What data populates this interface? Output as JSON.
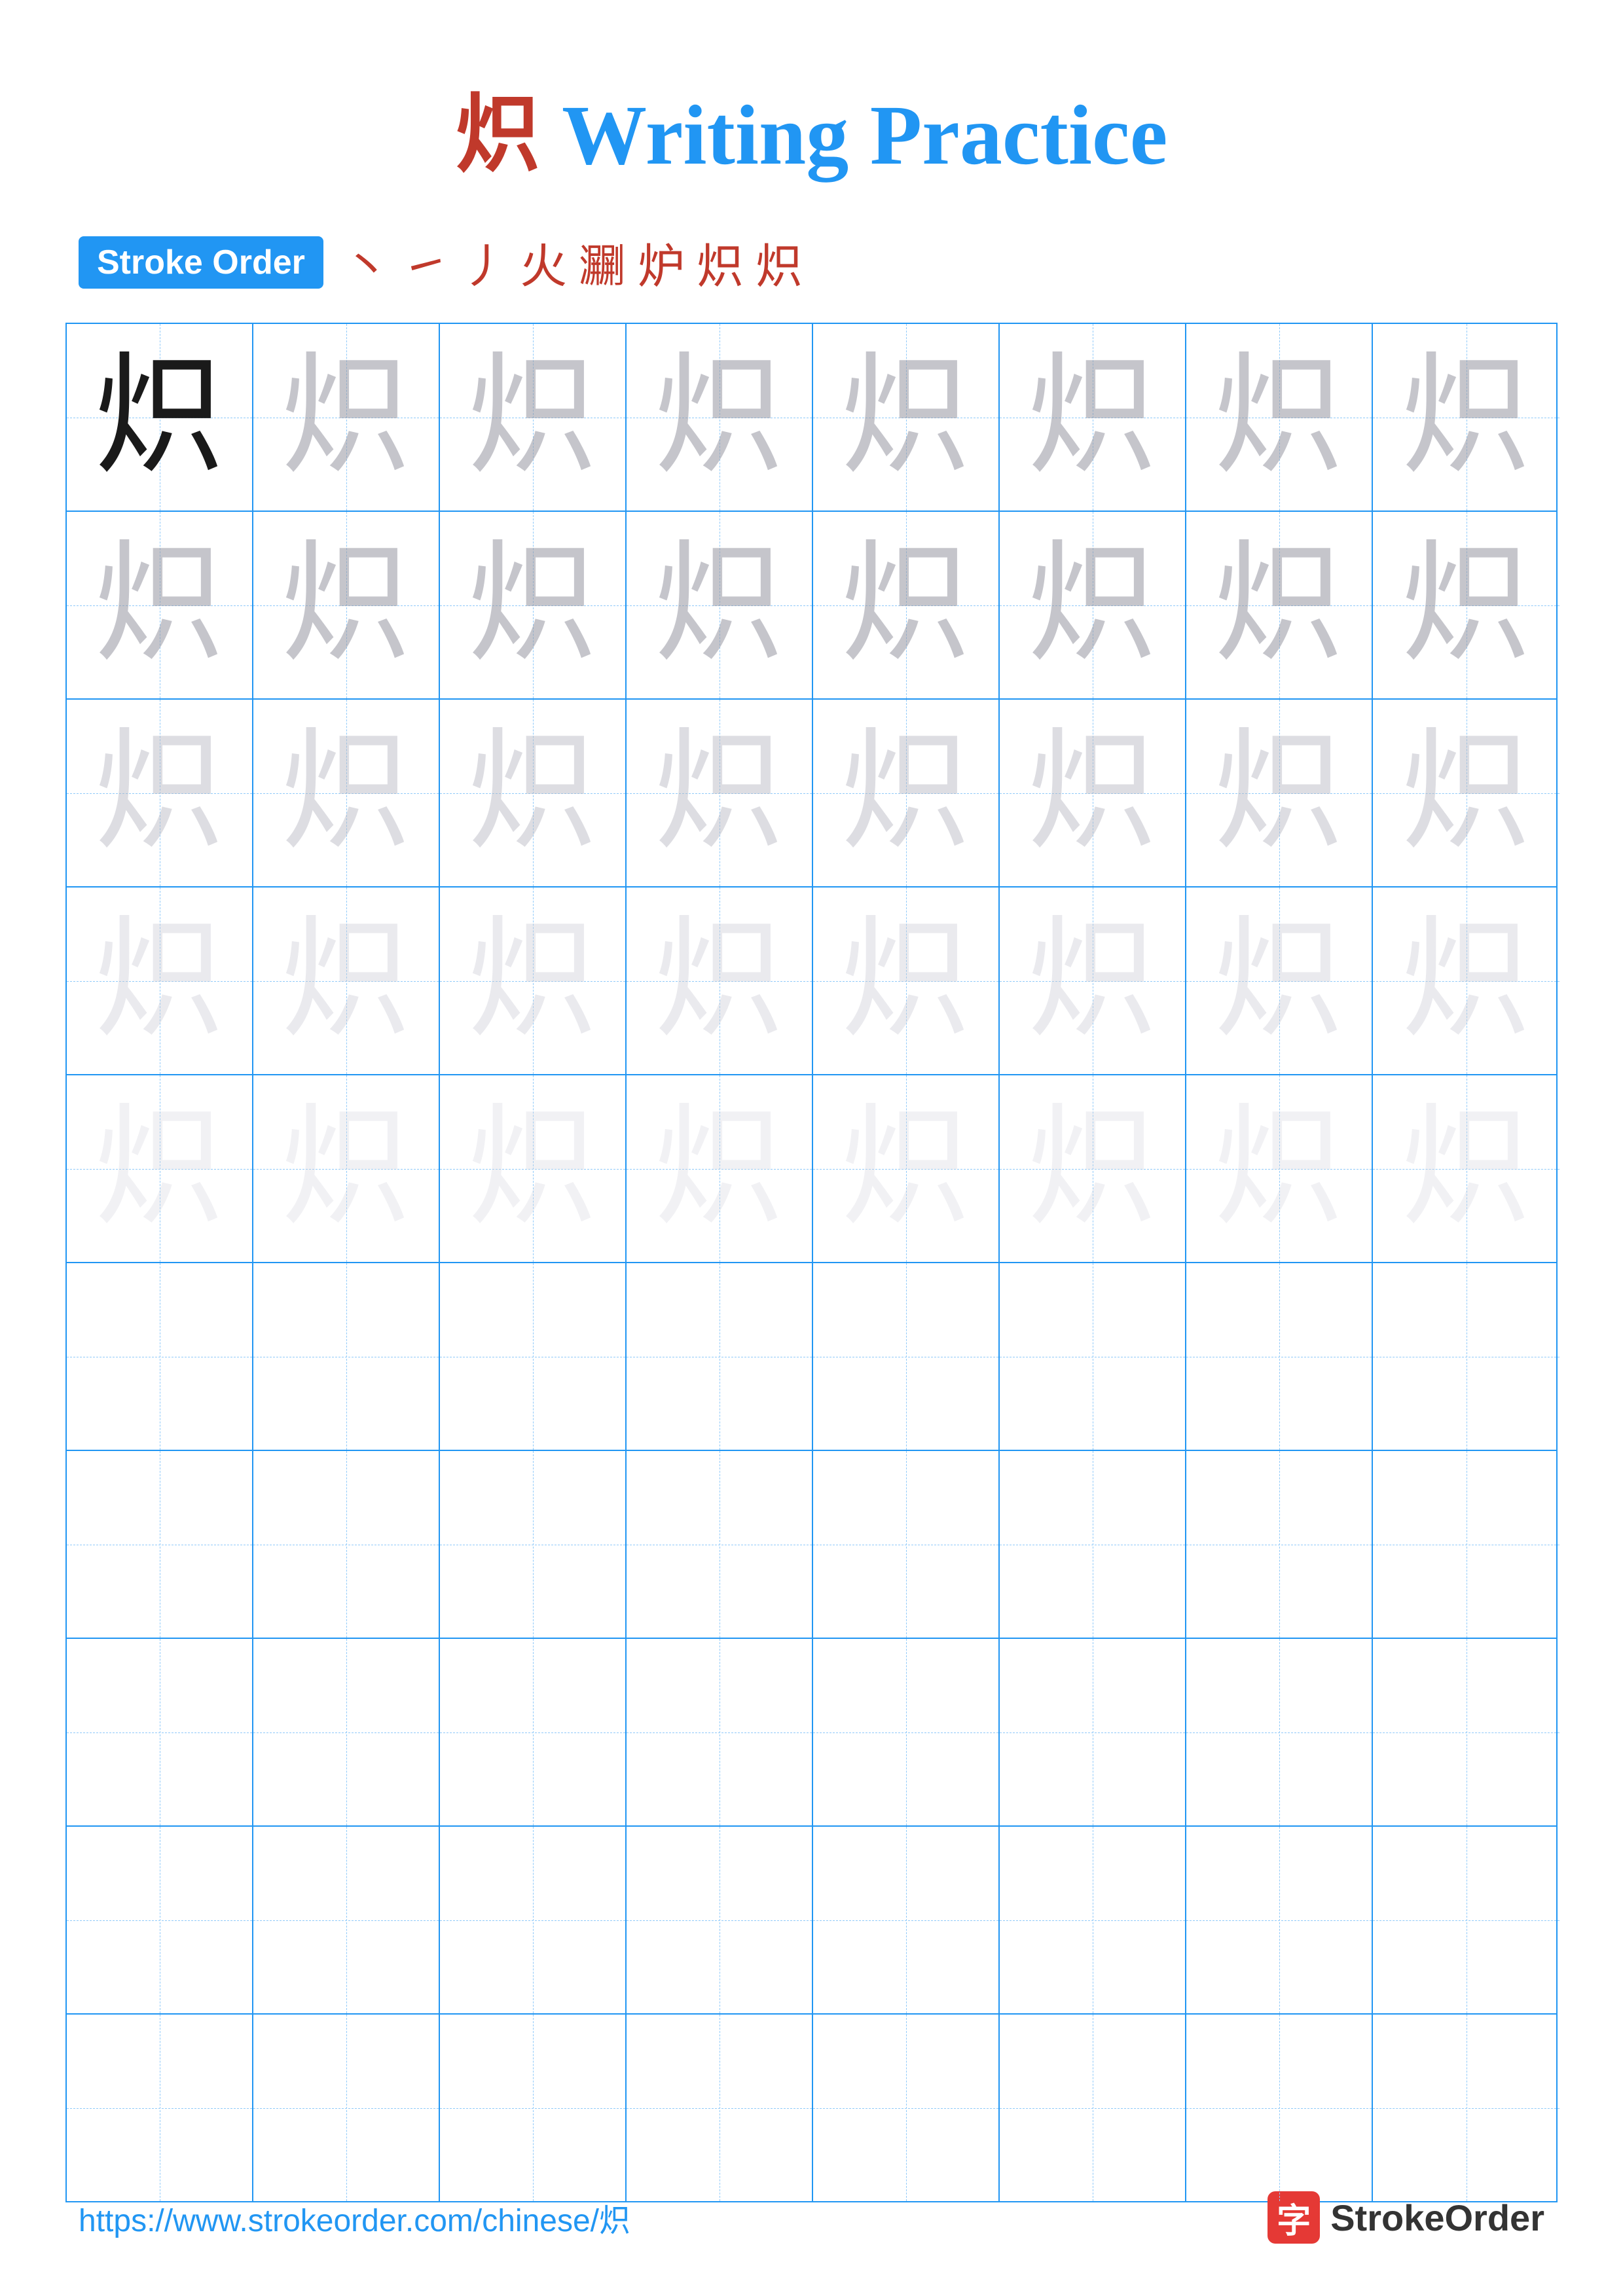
{
  "page": {
    "title": "炽 Writing Practice",
    "char": "炽",
    "title_char": "炽",
    "title_text": "Writing Practice"
  },
  "stroke_order": {
    "badge_label": "Stroke Order",
    "strokes": [
      "丶",
      "㇀",
      "丿",
      "火",
      "㶜",
      "炉",
      "炽",
      "炽"
    ]
  },
  "grid": {
    "rows": 10,
    "cols": 8
  },
  "footer": {
    "url": "https://www.strokeorder.com/chinese/炽",
    "brand_icon": "字",
    "brand_name": "StrokeOrder"
  }
}
